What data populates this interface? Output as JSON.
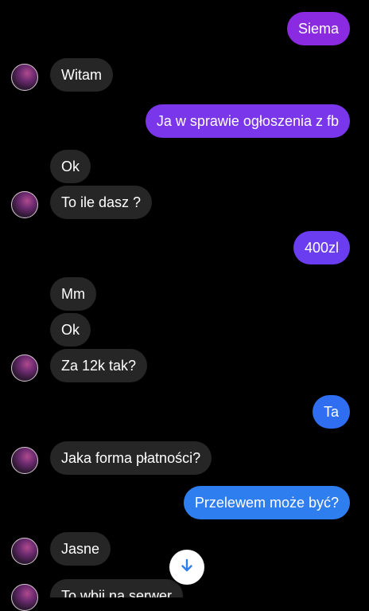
{
  "colors": {
    "background": "#000000",
    "incoming_bubble": "#262626",
    "outgoing_purple": "#8a2be2",
    "outgoing_violet": "#6a3df0",
    "outgoing_blue": "#2f7ef0"
  },
  "messages": [
    {
      "id": "m1",
      "side": "out",
      "text": "Siema"
    },
    {
      "id": "m2",
      "side": "in",
      "text": "Witam"
    },
    {
      "id": "m3",
      "side": "out",
      "text": "Ja w sprawie ogłoszenia z fb"
    },
    {
      "id": "m4",
      "side": "in",
      "text": "Ok"
    },
    {
      "id": "m5",
      "side": "in",
      "text": "To ile dasz ?"
    },
    {
      "id": "m6",
      "side": "out",
      "text": "400zl"
    },
    {
      "id": "m7",
      "side": "in",
      "text": "Mm"
    },
    {
      "id": "m8",
      "side": "in",
      "text": "Ok"
    },
    {
      "id": "m9",
      "side": "in",
      "text": "Za 12k tak?"
    },
    {
      "id": "m10",
      "side": "out",
      "text": "Ta"
    },
    {
      "id": "m11",
      "side": "in",
      "text": "Jaka forma płatności?"
    },
    {
      "id": "m12",
      "side": "out",
      "text": "Przelewem może być?"
    },
    {
      "id": "m13",
      "side": "in",
      "text": "Jasne"
    },
    {
      "id": "m14",
      "side": "in",
      "text": "To wbij na serwer"
    }
  ],
  "scroll_button": {
    "icon": "arrow-down-icon"
  }
}
